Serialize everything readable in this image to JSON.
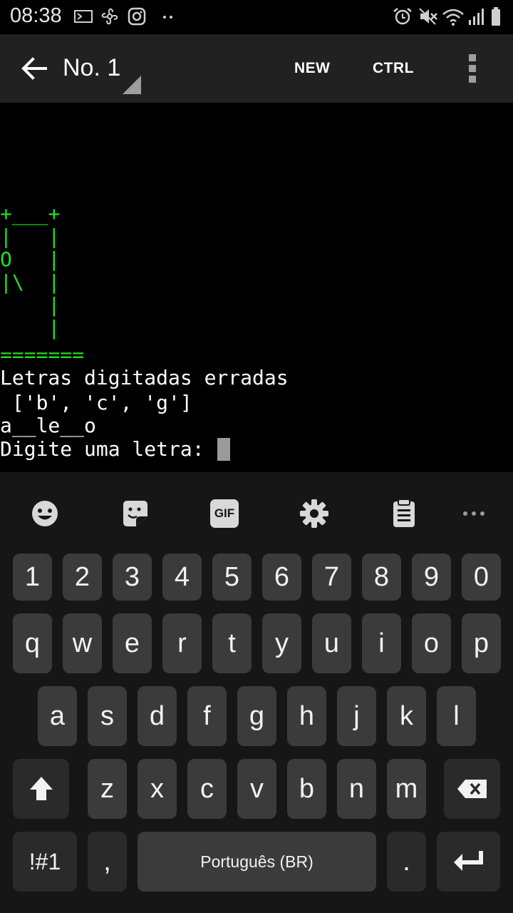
{
  "status_bar": {
    "time": "08:38",
    "left_icons": [
      "terminal-notification-icon",
      "pinwheel-icon",
      "instagram-icon",
      "more-dots-icon"
    ],
    "right_icons": [
      "alarm-icon",
      "mute-icon",
      "wifi-icon",
      "signal-icon",
      "battery-icon"
    ]
  },
  "app_bar": {
    "title": "No. 1",
    "actions": {
      "new": "NEW",
      "ctrl": "CTRL"
    }
  },
  "terminal": {
    "hangman_art": [
      "+___+",
      "|   |",
      "O   |",
      "|\\  |",
      "    |",
      "    |",
      "======="
    ],
    "lines": [
      "Letras digitadas erradas",
      " ['b', 'c', 'g']",
      "a__le__o",
      "Digite uma letra: "
    ],
    "colors": {
      "art": "#1ee01e",
      "text": "#ffffff",
      "cursor": "#9a9a9a"
    }
  },
  "keyboard": {
    "toolbar": [
      "emoji-icon",
      "sticker-icon",
      "gif-icon",
      "settings-icon",
      "clipboard-icon",
      "more-horizontal-icon"
    ],
    "gif_label": "GIF",
    "row_numbers": [
      "1",
      "2",
      "3",
      "4",
      "5",
      "6",
      "7",
      "8",
      "9",
      "0"
    ],
    "row_top": [
      "q",
      "w",
      "e",
      "r",
      "t",
      "y",
      "u",
      "i",
      "o",
      "p"
    ],
    "row_mid": [
      "a",
      "s",
      "d",
      "f",
      "g",
      "h",
      "j",
      "k",
      "l"
    ],
    "row_bottom": [
      "z",
      "x",
      "c",
      "v",
      "b",
      "n",
      "m"
    ],
    "symbols": "!#1",
    "comma": ",",
    "space": "Português (BR)",
    "period": "."
  }
}
